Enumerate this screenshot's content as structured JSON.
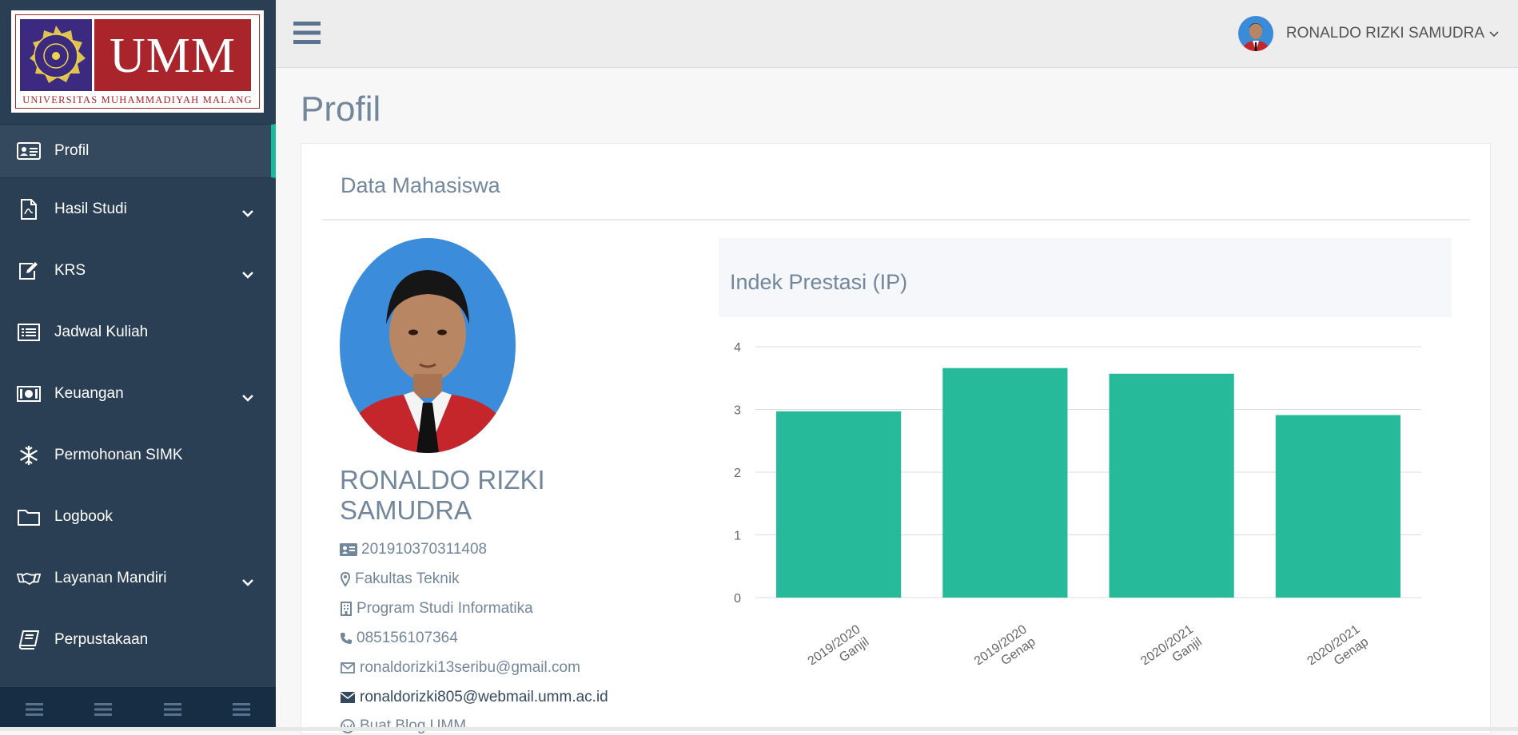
{
  "logo": {
    "text": "UMM",
    "subtitle": "UNIVERSITAS MUHAMMADIYAH MALANG"
  },
  "sidebar": {
    "items": [
      {
        "label": "Profil",
        "icon": "id-card-icon",
        "active": true,
        "has_chevron": false
      },
      {
        "label": "Hasil Studi",
        "icon": "file-pdf-icon",
        "has_chevron": true
      },
      {
        "label": "KRS",
        "icon": "edit-icon",
        "has_chevron": true
      },
      {
        "label": "Jadwal Kuliah",
        "icon": "list-alt-icon",
        "has_chevron": false
      },
      {
        "label": "Keuangan",
        "icon": "money-icon",
        "has_chevron": true
      },
      {
        "label": "Permohonan SIMK",
        "icon": "snowflake-icon",
        "has_chevron": false
      },
      {
        "label": "Logbook",
        "icon": "folder-icon",
        "has_chevron": false
      },
      {
        "label": "Layanan Mandiri",
        "icon": "handshake-icon",
        "has_chevron": true
      },
      {
        "label": "Perpustakaan",
        "icon": "book-icon",
        "has_chevron": false
      }
    ],
    "accent": "#1abb9c",
    "background": "#2a3f54"
  },
  "topnav": {
    "user_name": "RONALDO RIZKI SAMUDRA"
  },
  "page": {
    "title": "Profil"
  },
  "panel": {
    "title": "Data Mahasiswa"
  },
  "profile": {
    "name": "RONALDO RIZKI SAMUDRA",
    "nim": "201910370311408",
    "fakultas": "Fakultas Teknik",
    "prodi": "Program Studi Informatika",
    "phone": "085156107364",
    "email_personal": "ronaldorizki13seribu@gmail.com",
    "email_umm": "ronaldorizki805@webmail.umm.ac.id",
    "blog": "Buat Blog UMM"
  },
  "chart_header": "Indek Prestasi (IP)",
  "chart_data": {
    "type": "bar",
    "categories": [
      [
        "2019/2020",
        "Ganjil"
      ],
      [
        "2019/2020",
        "Genap"
      ],
      [
        "2020/2021",
        "Ganjil"
      ],
      [
        "2020/2021",
        "Genap"
      ]
    ],
    "values": [
      2.97,
      3.66,
      3.57,
      2.91
    ],
    "ylim": [
      0,
      4
    ],
    "yticks": [
      "0",
      "1",
      "2",
      "3",
      "4"
    ],
    "bar_color": "#26b99a",
    "grid": true
  }
}
